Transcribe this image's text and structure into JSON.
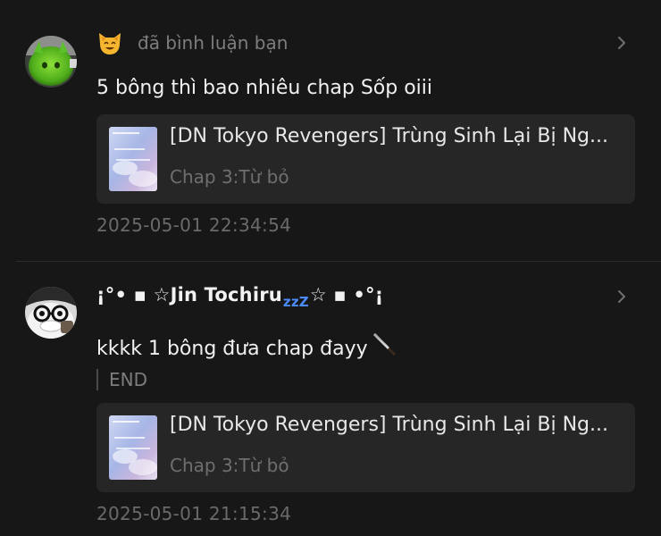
{
  "colors": {
    "background": "#171717",
    "card_background": "#262626",
    "primary_text": "#f0f0f0",
    "muted_text": "#7d7d7d"
  },
  "comments": [
    {
      "header_text": "đã bình luận bạn",
      "header_icon": "cat-emoji-icon",
      "text": "5 bông thì bao nhiêu chap Sốp oiii",
      "quote": null,
      "card": {
        "title": "[DN Tokyo Revengers] Trùng Sinh Lại Bị Ng...",
        "subtitle": "Chap 3:Từ bỏ"
      },
      "timestamp": "2025-05-01 22:34:54"
    },
    {
      "username": "¡°• ▪ ☆Jin Tochiru",
      "username_sleep": "zzZ",
      "username_tail": "☆ ▪ •°¡",
      "text": "kkkk 1 bông đưa chap đayy",
      "text_icon": "knife-icon",
      "quote": "END",
      "card": {
        "title": "[DN Tokyo Revengers] Trùng Sinh Lại Bị Ng...",
        "subtitle": "Chap 3:Từ bỏ"
      },
      "timestamp": "2025-05-01 21:15:34"
    }
  ]
}
